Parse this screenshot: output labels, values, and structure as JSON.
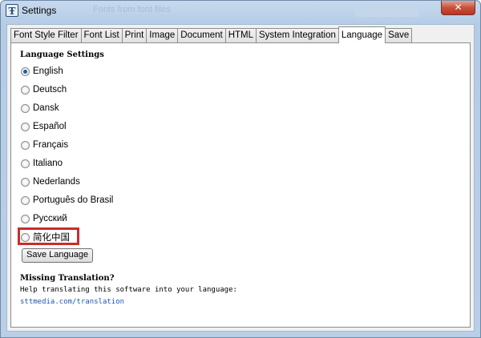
{
  "window": {
    "title": "Settings",
    "ghost_title": "Fonts from font files",
    "close_glyph": "✕",
    "icon_glyph": "Ŧ"
  },
  "tabs": [
    {
      "label": "Font Style Filter",
      "active": false
    },
    {
      "label": "Font List",
      "active": false
    },
    {
      "label": "Print",
      "active": false
    },
    {
      "label": "Image",
      "active": false
    },
    {
      "label": "Document",
      "active": false
    },
    {
      "label": "HTML",
      "active": false
    },
    {
      "label": "System Integration",
      "active": false
    },
    {
      "label": "Language",
      "active": true
    },
    {
      "label": "Save",
      "active": false
    }
  ],
  "language_section": {
    "title": "Language Settings",
    "options": [
      {
        "label": "English",
        "checked": true
      },
      {
        "label": "Deutsch",
        "checked": false
      },
      {
        "label": "Dansk",
        "checked": false
      },
      {
        "label": "Español",
        "checked": false
      },
      {
        "label": "Français",
        "checked": false
      },
      {
        "label": "Italiano",
        "checked": false
      },
      {
        "label": "Nederlands",
        "checked": false
      },
      {
        "label": "Português do Brasil",
        "checked": false
      },
      {
        "label": "Русский",
        "checked": false
      },
      {
        "label": "简化中国",
        "checked": false
      }
    ],
    "save_button": "Save Language"
  },
  "missing": {
    "title": "Missing Translation?",
    "help": "Help translating this software into your language:",
    "link": "sttmedia.com/translation"
  },
  "colors": {
    "highlight": "#cc2b2b",
    "link": "#1b57b0",
    "radio_checked": "#1d5fa8"
  }
}
